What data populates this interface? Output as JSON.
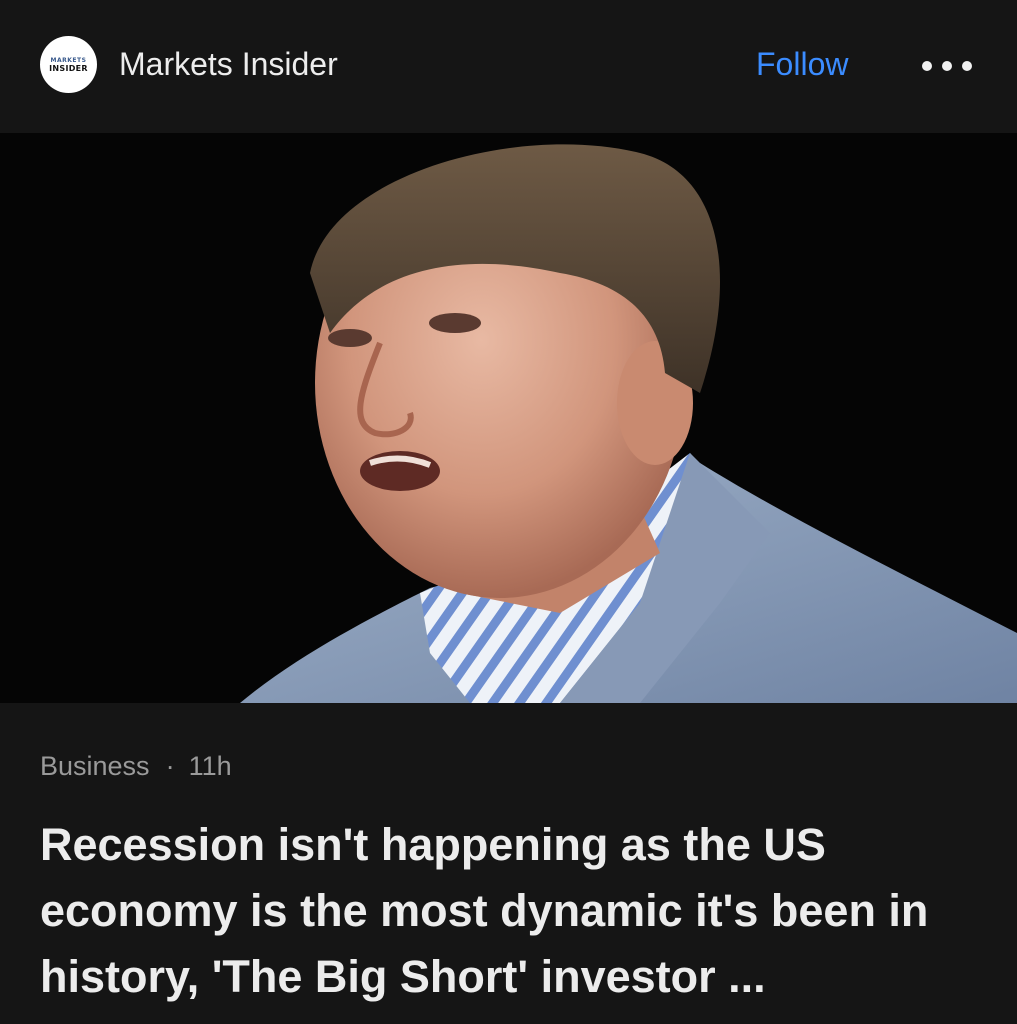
{
  "header": {
    "logo_line1": "MARKETS",
    "logo_line2": "INSIDER",
    "publisher_name": "Markets Insider",
    "follow_label": "Follow",
    "more_icon": "more-horizontal-icon"
  },
  "article": {
    "category": "Business",
    "separator": "·",
    "age": "11h",
    "headline": "Recession isn't happening as the US economy is the most dynamic it's been in history, 'The Big Short' investor ..."
  },
  "colors": {
    "background": "#151515",
    "accent": "#3b8cff",
    "meta_text": "#9a9a9a"
  }
}
